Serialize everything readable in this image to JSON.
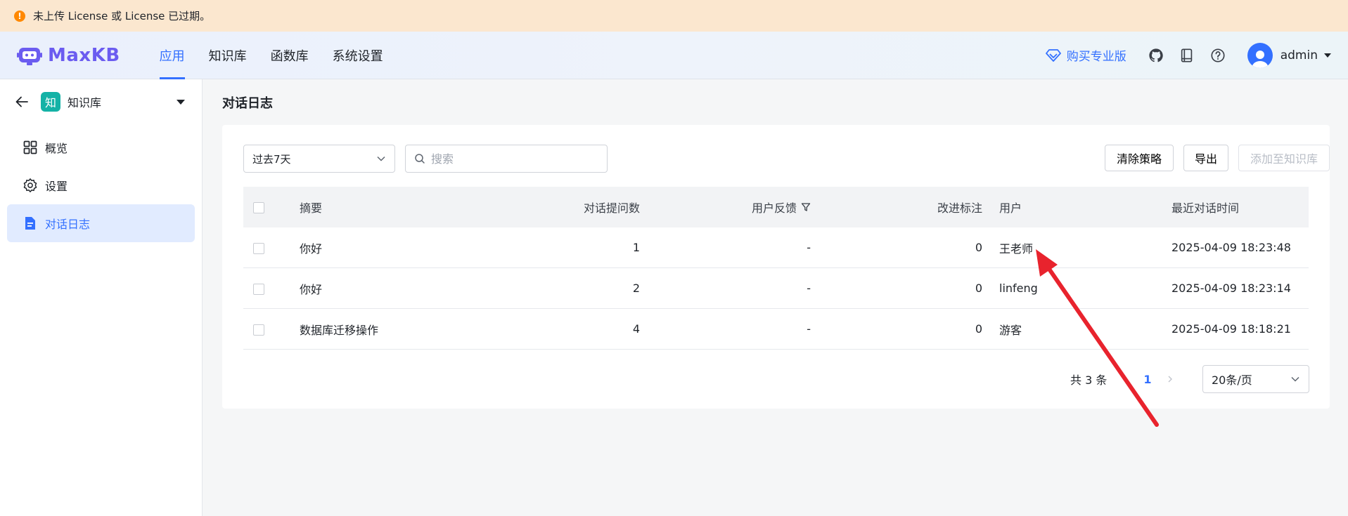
{
  "alert": {
    "text": "未上传 License 或 License 已过期。"
  },
  "header": {
    "logo_text": "MaxKB",
    "nav": [
      {
        "label": "应用",
        "active": true
      },
      {
        "label": "知识库",
        "active": false
      },
      {
        "label": "函数库",
        "active": false
      },
      {
        "label": "系统设置",
        "active": false
      }
    ],
    "buy_label": "购买专业版",
    "icons": [
      "github-icon",
      "book-icon",
      "help-icon"
    ],
    "username": "admin"
  },
  "sidebar": {
    "kb_badge": "知",
    "kb_name": "知识库",
    "items": [
      {
        "label": "概览",
        "icon": "grid-icon",
        "active": false
      },
      {
        "label": "设置",
        "icon": "gear-icon",
        "active": false
      },
      {
        "label": "对话日志",
        "icon": "document-icon",
        "active": true
      }
    ]
  },
  "main": {
    "title": "对话日志",
    "filter": {
      "selected": "过去7天"
    },
    "search": {
      "placeholder": "搜索",
      "value": ""
    },
    "buttons": {
      "clear": "清除策略",
      "export": "导出",
      "add_to_kb": "添加至知识库"
    },
    "table": {
      "headers": {
        "summary": "摘要",
        "questions": "对话提问数",
        "feedback": "用户反馈",
        "improve": "改进标注",
        "user": "用户",
        "last_time": "最近对话时间"
      },
      "rows": [
        {
          "summary": "你好",
          "questions": "1",
          "feedback": "-",
          "improve": "0",
          "user": "王老师",
          "last_time": "2025-04-09 18:23:48"
        },
        {
          "summary": "你好",
          "questions": "2",
          "feedback": "-",
          "improve": "0",
          "user": "linfeng",
          "last_time": "2025-04-09 18:23:14"
        },
        {
          "summary": "数据库迁移操作",
          "questions": "4",
          "feedback": "-",
          "improve": "0",
          "user": "游客",
          "last_time": "2025-04-09 18:18:21"
        }
      ]
    },
    "pagination": {
      "total": "共 3 条",
      "current": "1",
      "page_size": "20条/页"
    }
  },
  "colors": {
    "accent": "#3370ff",
    "annotation_arrow": "#e8232d",
    "alert_bg": "#fbe7cf",
    "kb_badge": "#14b2a6"
  }
}
